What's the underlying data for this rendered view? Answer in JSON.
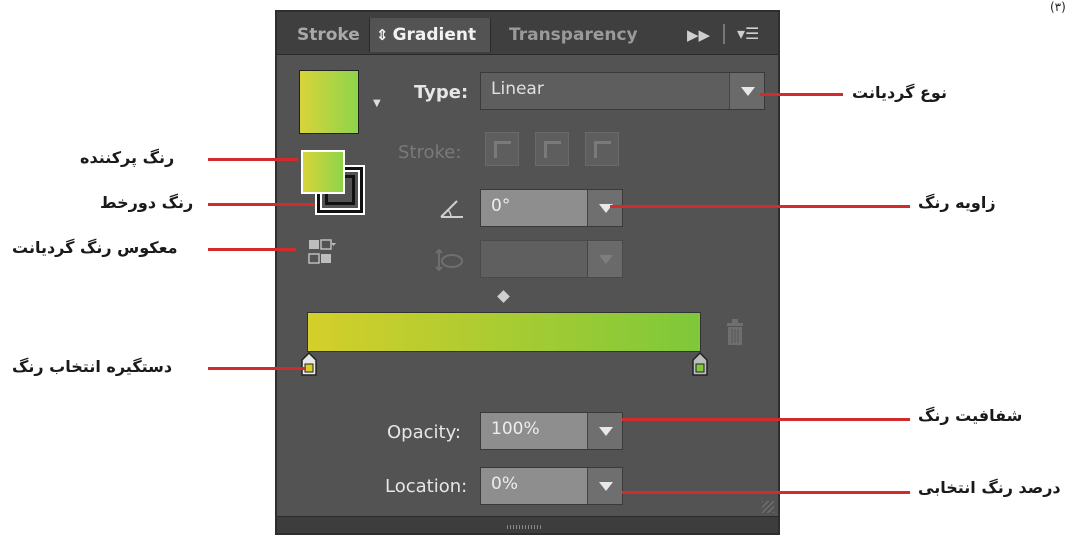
{
  "corner_mark": "(۳)",
  "panel": {
    "tabs": {
      "stroke": "Stroke",
      "gradient_prefix": "⇕",
      "gradient": "Gradient",
      "transparency": "Transparency"
    },
    "type_label": "Type:",
    "type_value": "Linear",
    "stroke_label": "Stroke:",
    "angle_value": "0°",
    "aspect_value": "",
    "opacity_label": "Opacity:",
    "opacity_value": "100%",
    "location_label": "Location:",
    "location_value": "0%",
    "gradient_colors": [
      "#d4cf2a",
      "#7ec83a"
    ],
    "stop_colors": [
      "#d4cf2a",
      "#7ec83a"
    ]
  },
  "callouts": {
    "gradient_type": "نوع گردیانت",
    "fill_color": "رنگ پرکننده",
    "stroke_color": "رنگ دورخط",
    "color_angle": "زاویه رنگ",
    "reverse_gradient": "معکوس رنگ گردیانت",
    "color_stop": "دستگیره انتخاب رنگ",
    "color_opacity": "شفافیت رنگ",
    "selected_color_percent": "درصد رنگ انتخابی"
  },
  "colors": {
    "panel_bg": "#535353",
    "callout_line": "#d32b2b"
  }
}
